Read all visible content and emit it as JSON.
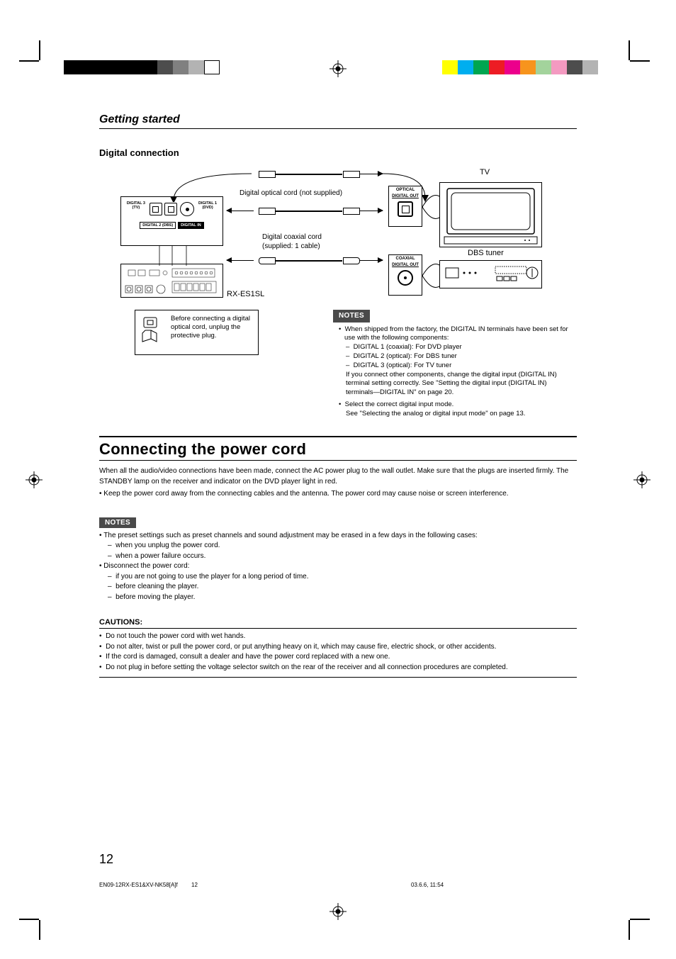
{
  "header": {
    "title": "Getting started"
  },
  "section": {
    "subtitle": "Digital connection"
  },
  "diagram": {
    "optical_cord": "Digital optical cord (not supplied)",
    "coaxial_cord": "Digital coaxial cord",
    "coaxial_supplied": "(supplied: 1 cable)",
    "receiver_name": "RX-ES1SL",
    "tv_label": "TV",
    "dbs_label": "DBS tuner",
    "optical_out_l1": "OPTICAL",
    "optical_out_l2": "DIGITAL OUT",
    "coax_out_l1": "COAXIAL",
    "coax_out_l2": "DIGITAL OUT",
    "inputs": {
      "d3": "DIGITAL 3\n(TV)",
      "d1": "DIGITAL 1\n(DVD)",
      "d2": "DIGITAL 2 (DBS)",
      "din": "DIGITAL IN"
    },
    "protective_plug_note": "Before connecting a digital optical cord, unplug the protective plug."
  },
  "notes1": {
    "badge": "NOTES",
    "n1": "When shipped from the factory, the DIGITAL IN terminals have been set for use with the following components:",
    "s1": "DIGITAL 1 (coaxial): For DVD player",
    "s2": "DIGITAL 2 (optical):  For DBS tuner",
    "s3": "DIGITAL 3 (optical):  For TV tuner",
    "c1": "If you connect other components, change the digital input (DIGITAL IN) terminal setting correctly. See \"Setting the digital input (DIGITAL IN) terminals—DIGITAL IN\" on page 20.",
    "n2": "Select the correct digital input mode.",
    "c2": "See \"Selecting the analog or digital input mode\" on page 13."
  },
  "power": {
    "heading": "Connecting the power cord",
    "p1": "When all the audio/video connections have been made, connect the AC power plug to the wall outlet. Make sure that the plugs are inserted firmly. The STANDBY lamp on the receiver and indicator on the DVD player light in red.",
    "p2": "Keep the power cord away from the connecting cables and the antenna. The power cord may cause noise or screen interference."
  },
  "notes2": {
    "badge": "NOTES",
    "n1": "The preset settings such as preset channels and sound adjustment may be erased in a few days in the following cases:",
    "s1": "when you unplug the power cord.",
    "s2": "when a power failure occurs.",
    "n2": "Disconnect the power cord:",
    "s3": "if you are not going to use the player for a long period of time.",
    "s4": "before cleaning the player.",
    "s5": "before moving the player."
  },
  "cautions": {
    "title": "CAUTIONS:",
    "c1": "Do not touch the power cord with wet hands.",
    "c2": "Do not alter, twist or pull the power cord, or put anything heavy on it, which may cause fire, electric shock, or other accidents.",
    "c3": "If the cord is damaged, consult a dealer and have the power cord replaced with a new one.",
    "c4": "Do not plug in before setting the voltage selector switch on the rear of the receiver and all connection procedures are completed."
  },
  "footer": {
    "page": "12",
    "file": "EN09-12RX-ES1&XV-NK58[A]f",
    "page_small": "12",
    "timestamp": "03.6.6, 11:54"
  },
  "colors": {
    "left_bar": [
      "#000",
      "#000",
      "#000",
      "#000",
      "#000",
      "#000",
      "#4d4d4d",
      "#808080",
      "#b3b3b3",
      "#fff"
    ],
    "right_bar": [
      "#ffff00",
      "#00aeef",
      "#00a651",
      "#ed1c24",
      "#ec008c",
      "#f7941d",
      "#a3d39c",
      "#f49ac1",
      "#4d4d4d",
      "#b3b3b3"
    ]
  }
}
